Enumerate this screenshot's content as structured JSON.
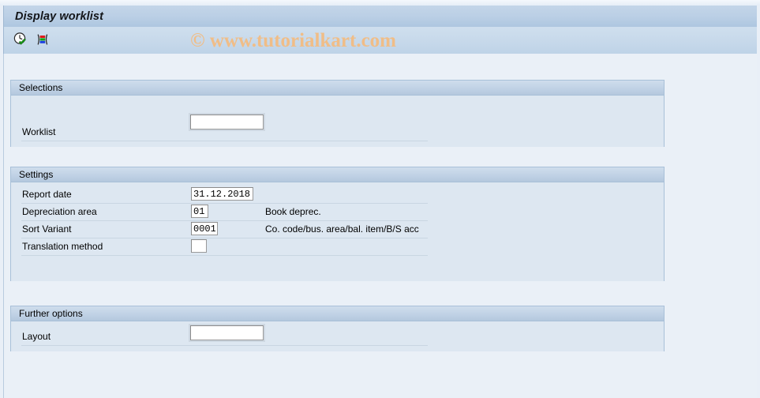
{
  "window": {
    "title": "Display worklist"
  },
  "toolbar": {
    "buttons": [
      {
        "icon": "clock-check-icon",
        "name": "execute-icon"
      },
      {
        "icon": "color-bars-icon",
        "name": "variant-icon"
      }
    ]
  },
  "watermark": {
    "text": "© www.tutorialkart.com",
    "color": "#f0bd87"
  },
  "panels": {
    "selections": {
      "title": "Selections",
      "rows": [
        {
          "label": "Worklist",
          "value": "",
          "desc": ""
        }
      ]
    },
    "settings": {
      "title": "Settings",
      "rows": [
        {
          "label": "Report date",
          "value": "31.12.2018",
          "desc": ""
        },
        {
          "label": "Depreciation area",
          "value": "01",
          "desc": "Book deprec."
        },
        {
          "label": "Sort Variant",
          "value": "0001",
          "desc": "Co. code/bus. area/bal. item/B/S acc"
        },
        {
          "label": "Translation method",
          "value": "",
          "desc": ""
        }
      ]
    },
    "further_options": {
      "title": "Further options",
      "rows": [
        {
          "label": "Layout",
          "value": "",
          "desc": ""
        }
      ]
    }
  },
  "colors": {
    "page_background": "#eaf0f7",
    "panel_background": "#dde7f1",
    "panel_header": "#c2d3e6",
    "title_bar": "#bcd0e6",
    "border": "#a8c0d8"
  }
}
